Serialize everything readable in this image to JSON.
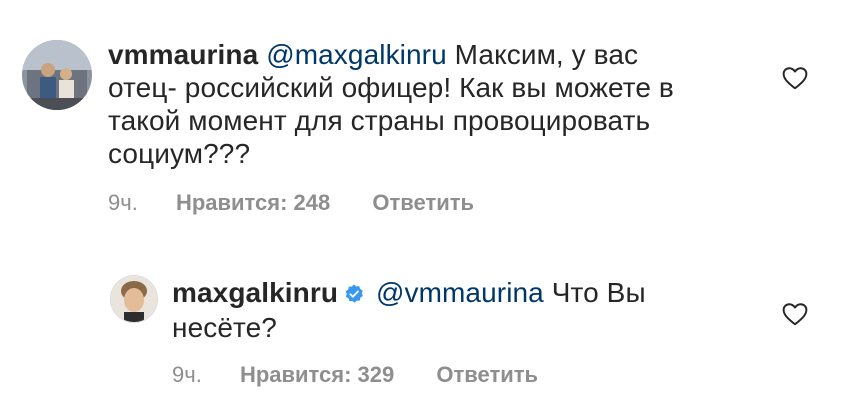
{
  "comments": [
    {
      "username": "vmmaurina",
      "mention": "@maxgalkinru",
      "text_lines": [
        "Максим, у вас",
        "отец- российский офицер! Как вы можете в",
        "такой момент для страны провоцировать",
        "социум???"
      ],
      "time": "9ч.",
      "likes": "Нравится: 248",
      "reply": "Ответить",
      "verified": false
    },
    {
      "username": "maxgalkinru",
      "mention": "@vmmaurina",
      "text_lines": [
        "Что Вы",
        "несёте?"
      ],
      "time": "9ч.",
      "likes": "Нравится: 329",
      "reply": "Ответить",
      "verified": true
    }
  ],
  "icons": {
    "like": "heart-outline-icon",
    "verified_badge": "verified-badge-icon",
    "verified_color": "#3897f0",
    "mention_color": "#00376b",
    "meta_color": "#8e8e8e"
  }
}
